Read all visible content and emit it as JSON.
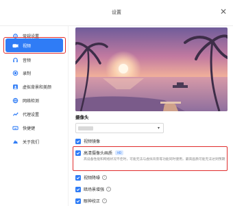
{
  "window": {
    "title": "设置",
    "close_icon": "close-icon"
  },
  "sidebar": {
    "items": [
      {
        "label": "常规设置",
        "icon": "gear-icon"
      },
      {
        "label": "视频",
        "icon": "camera-icon",
        "active": true
      },
      {
        "label": "音频",
        "icon": "headset-icon"
      },
      {
        "label": "录制",
        "icon": "record-icon"
      },
      {
        "label": "虚拟背景和美颜",
        "icon": "portrait-icon"
      },
      {
        "label": "网络检测",
        "icon": "network-icon"
      },
      {
        "label": "代理设置",
        "icon": "proxy-icon"
      },
      {
        "label": "快捷键",
        "icon": "keyboard-icon"
      },
      {
        "label": "关于我们",
        "icon": "info-icon"
      }
    ]
  },
  "main": {
    "camera_label": "摄像头",
    "mirror_label": "视频镜像",
    "hd_label": "高清摄像头画质",
    "hd_badge": "HD",
    "hd_desc": "高设备性能和网络状况不佳时，可能无法与虚拟背景等功能同时使用，最高画质可能无法达到预期",
    "denoise_label": "视频降噪",
    "enhance_label": "暗场景增强",
    "beauty_label": "眼神校正"
  },
  "colors": {
    "accent": "#2f7cf6",
    "highlight": "#e02b2b"
  }
}
